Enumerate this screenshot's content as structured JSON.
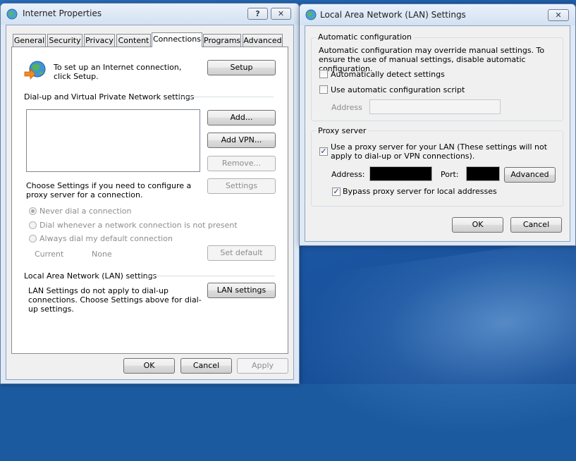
{
  "internet_properties": {
    "title": "Internet Properties",
    "help_glyph": "?",
    "close_glyph": "✕",
    "tabs": [
      {
        "label": "General"
      },
      {
        "label": "Security"
      },
      {
        "label": "Privacy"
      },
      {
        "label": "Content"
      },
      {
        "label": "Connections",
        "active": true
      },
      {
        "label": "Programs"
      },
      {
        "label": "Advanced"
      }
    ],
    "setup_text": "To set up an Internet connection, click Setup.",
    "setup_button": "Setup",
    "dialup_header": "Dial-up and Virtual Private Network settings",
    "add_button": "Add...",
    "add_vpn_button": "Add VPN...",
    "remove_button": "Remove...",
    "settings_text": "Choose Settings if you need to configure a proxy server for a connection.",
    "settings_button": "Settings",
    "radios": [
      {
        "label": "Never dial a connection",
        "checked": true
      },
      {
        "label": "Dial whenever a network connection is not present",
        "checked": false
      },
      {
        "label": "Always dial my default connection",
        "checked": false
      }
    ],
    "current_label": "Current",
    "current_value": "None",
    "set_default_button": "Set default",
    "lan_header": "Local Area Network (LAN) settings",
    "lan_text": "LAN Settings do not apply to dial-up connections. Choose Settings above for dial-up settings.",
    "lan_settings_button": "LAN settings",
    "ok_button": "OK",
    "cancel_button": "Cancel",
    "apply_button": "Apply"
  },
  "lan_dialog": {
    "title": "Local Area Network (LAN) Settings",
    "close_glyph": "✕",
    "auto_config_header": "Automatic configuration",
    "auto_config_text": "Automatic configuration may override manual settings.  To ensure the use of manual settings, disable automatic configuration.",
    "auto_detect_label": "Automatically detect settings",
    "auto_detect_checked": false,
    "auto_script_label": "Use automatic configuration script",
    "auto_script_checked": false,
    "script_address_label": "Address",
    "script_address_value": "",
    "proxy_header": "Proxy server",
    "use_proxy_label": "Use a proxy server for your LAN (These settings will not apply to dial-up or VPN connections).",
    "use_proxy_checked": true,
    "address_label": "Address:",
    "port_label": "Port:",
    "advanced_button": "Advanced",
    "bypass_label": "Bypass proxy server for local addresses",
    "bypass_checked": true,
    "ok_button": "OK",
    "cancel_button": "Cancel",
    "check_glyph": "✓"
  }
}
